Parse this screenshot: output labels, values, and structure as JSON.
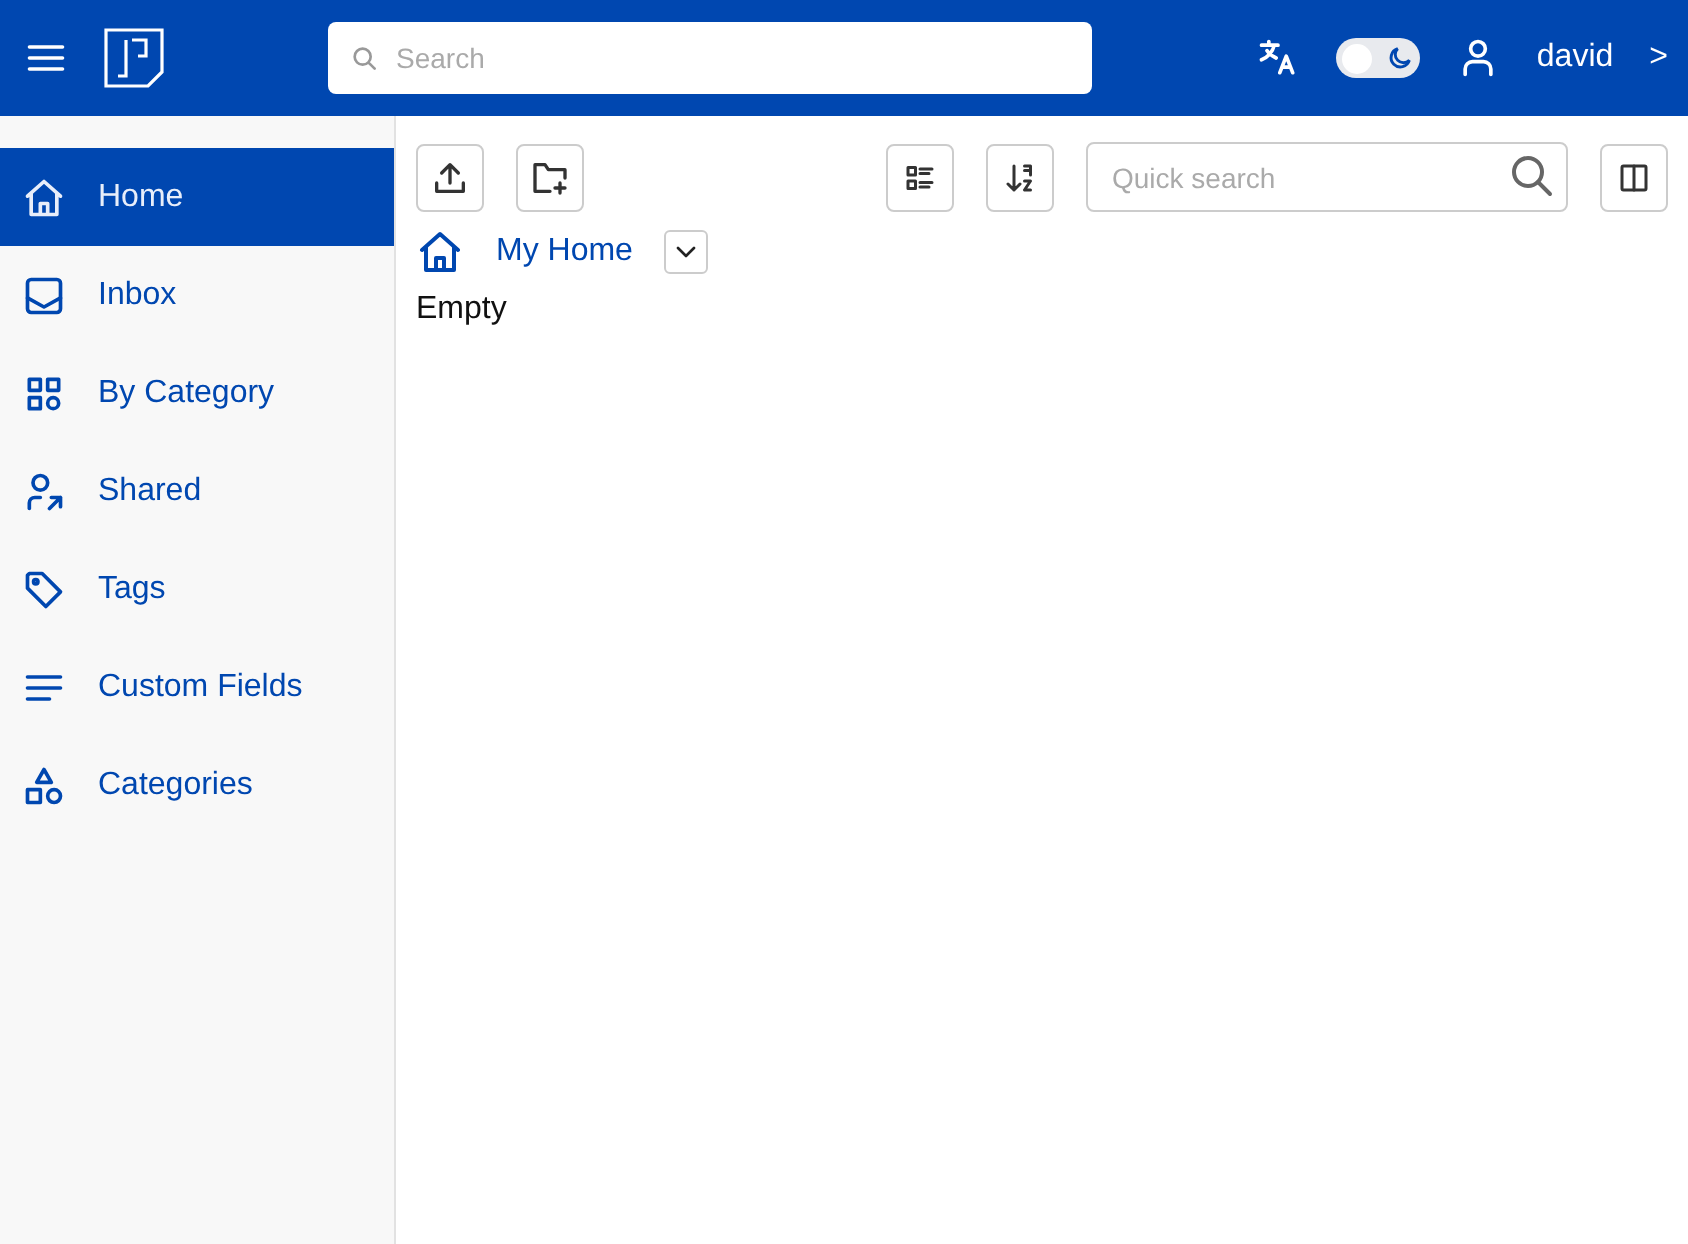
{
  "header": {
    "search": {
      "placeholder": "Search"
    },
    "dark_mode": {
      "on": false
    },
    "user": "david",
    "expand": ">"
  },
  "sidebar": {
    "items": [
      {
        "label": "Home",
        "selected": true
      },
      {
        "label": "Inbox",
        "selected": false
      },
      {
        "label": "By Category",
        "selected": false
      },
      {
        "label": "Shared",
        "selected": false
      },
      {
        "label": "Tags",
        "selected": false
      },
      {
        "label": "Custom Fields",
        "selected": false
      },
      {
        "label": "Categories",
        "selected": false
      }
    ]
  },
  "toolbar": {
    "quick_search": {
      "placeholder": "Quick search"
    }
  },
  "breadcrumb": {
    "label": "My Home"
  },
  "content": {
    "message": "Empty"
  }
}
